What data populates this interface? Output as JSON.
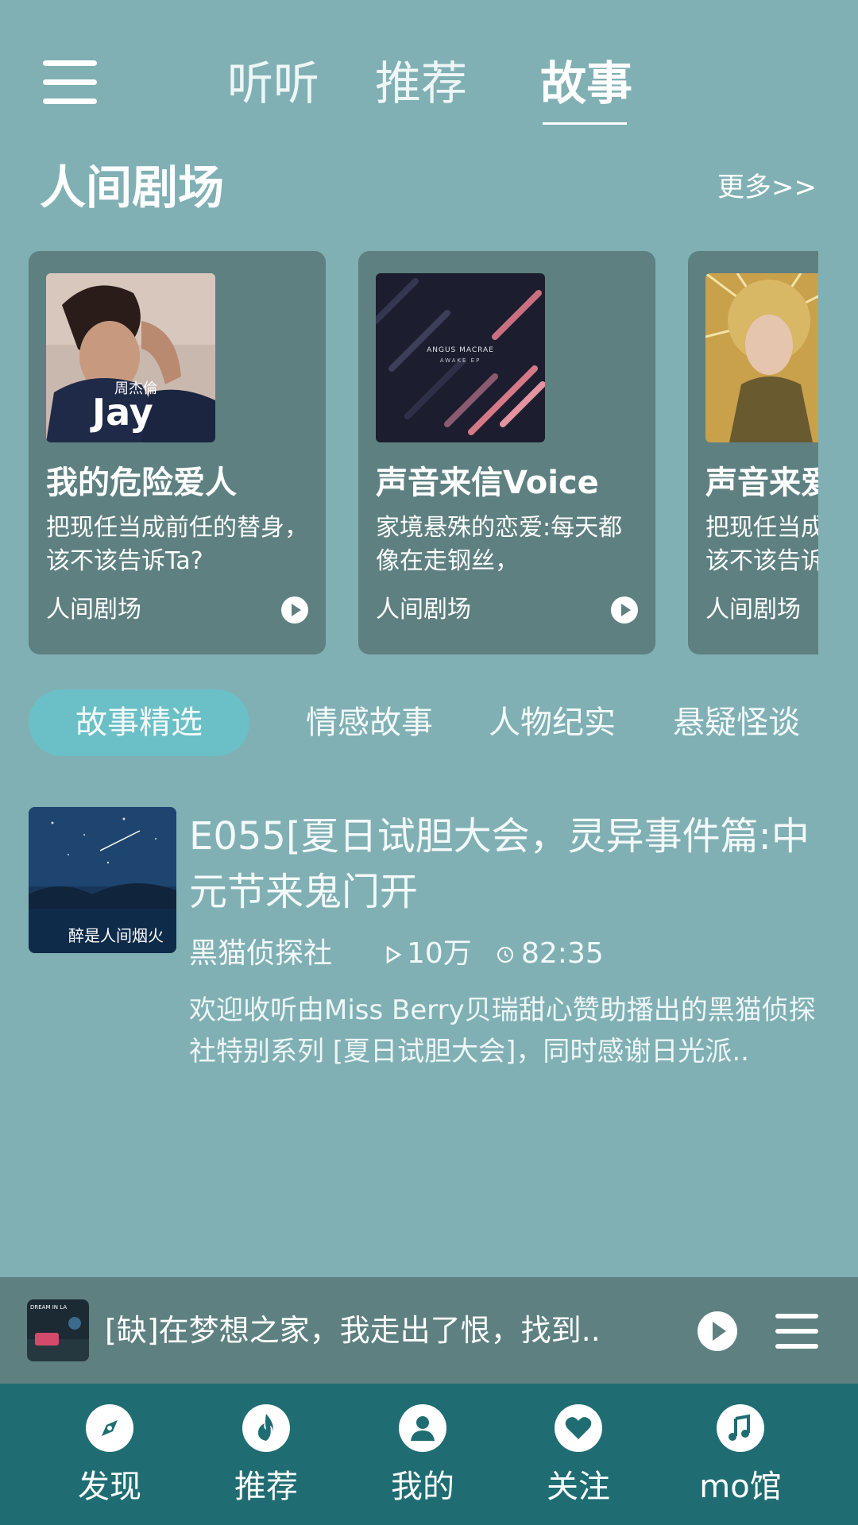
{
  "header": {
    "tabs": [
      {
        "label": "听听"
      },
      {
        "label": "推荐"
      },
      {
        "label": "故事"
      }
    ],
    "active_tab": "故事"
  },
  "section": {
    "title": "人间剧场",
    "more": "更多>>"
  },
  "cards": [
    {
      "title": "我的危险爱人",
      "desc": "把现任当成前任的替身，该不该告诉Ta?",
      "category": "人间剧场",
      "cover_text": "Jay",
      "cover_text2": "周杰倫"
    },
    {
      "title": "声音来信Voice",
      "desc": "家境悬殊的恋爱:每天都像在走钢丝，",
      "category": "人间剧场",
      "cover_text": "ANGUS MACRAE",
      "cover_text2": "AWAKE EP"
    },
    {
      "title": "声音来爱",
      "desc": "把现任当成前任的替身，该不该告诉",
      "category": "人间剧场"
    }
  ],
  "categories": [
    {
      "label": "故事精选"
    },
    {
      "label": "情感故事"
    },
    {
      "label": "人物纪实"
    },
    {
      "label": "悬疑怪谈"
    }
  ],
  "story": {
    "title": "E055[夏日试胆大会，灵异事件篇:中元节来鬼门开",
    "author": "黑猫侦探社",
    "plays": "10万",
    "duration": "82:35",
    "desc": "欢迎收听由Miss Berry贝瑞甜心赞助播出的黑猫侦探社特别系列 [夏日试胆大会]，同时感谢日光派..",
    "cover_text": "醉是人间烟火"
  },
  "player": {
    "title": "[缺]在梦想之家，我走出了恨，找到..",
    "cover_text": "DREAM IN LA"
  },
  "nav": [
    {
      "label": "发现",
      "icon": "compass-icon"
    },
    {
      "label": "推荐",
      "icon": "flame-icon"
    },
    {
      "label": "我的",
      "icon": "user-icon"
    },
    {
      "label": "关注",
      "icon": "heart-icon"
    },
    {
      "label": "mo馆",
      "icon": "music-note-icon"
    }
  ],
  "colors": {
    "background": "#80b0b4",
    "card": "#5e8081",
    "accent_pill": "#6ac0c6",
    "bottom_nav": "#1f6d72"
  }
}
